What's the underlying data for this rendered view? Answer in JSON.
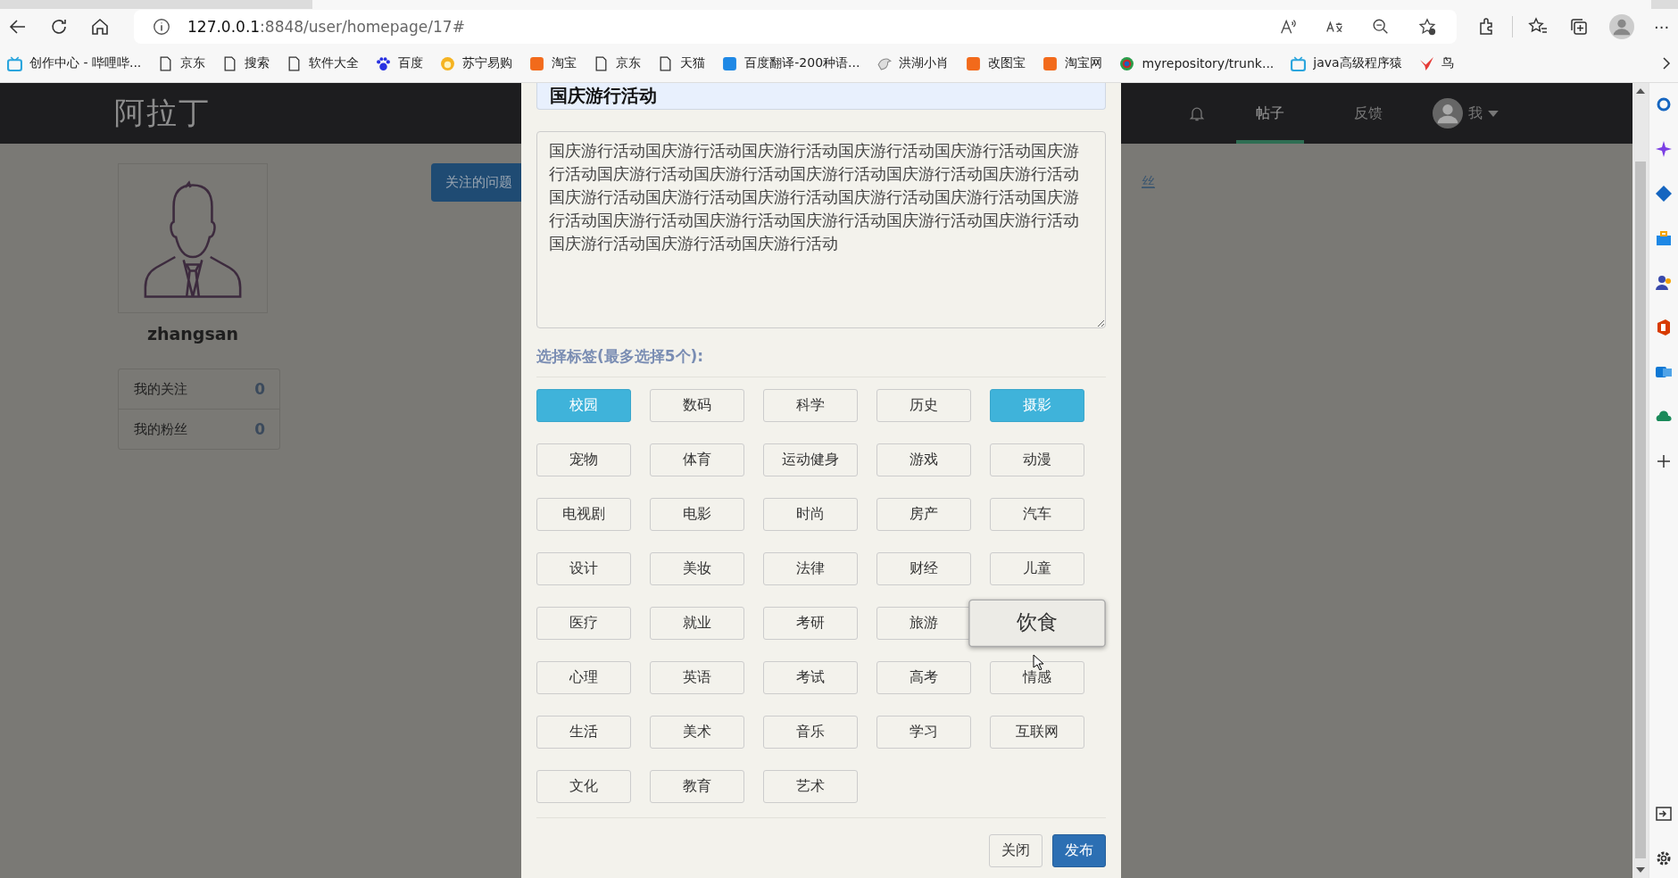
{
  "browser": {
    "url_host": "127.0.0.1",
    "url_path": ":8848/user/homepage/17#",
    "more": "···"
  },
  "bookmarks": [
    {
      "label": "创作中心 - 哔哩哔...",
      "kind": "tv"
    },
    {
      "label": "京东",
      "kind": "page"
    },
    {
      "label": "搜索",
      "kind": "page"
    },
    {
      "label": "软件大全",
      "kind": "page"
    },
    {
      "label": "百度",
      "kind": "paw"
    },
    {
      "label": "苏宁易购",
      "kind": "sun"
    },
    {
      "label": "淘宝",
      "kind": "orange"
    },
    {
      "label": "京东",
      "kind": "page"
    },
    {
      "label": "天猫",
      "kind": "page"
    },
    {
      "label": "百度翻译-200种语...",
      "kind": "blue"
    },
    {
      "label": "洪湖小肖",
      "kind": "bird"
    },
    {
      "label": "改图宝",
      "kind": "orange"
    },
    {
      "label": "淘宝网",
      "kind": "orange"
    },
    {
      "label": "myrepository/trunk...",
      "kind": "ring"
    },
    {
      "label": "java高级程序猿",
      "kind": "tv"
    },
    {
      "label": "鸟",
      "kind": "redbird"
    }
  ],
  "site": {
    "logo": "阿拉丁",
    "nav": [
      {
        "label": "帖子",
        "selected": true
      },
      {
        "label": "反馈",
        "selected": false
      }
    ],
    "user_menu": "我"
  },
  "profile": {
    "username": "zhangsan",
    "stats": [
      {
        "label": "我的关注",
        "value": "0"
      },
      {
        "label": "我的粉丝",
        "value": "0"
      }
    ]
  },
  "tab_button": "关注的问题",
  "link_fragment": "丝",
  "modal": {
    "title_value": "国庆游行活动",
    "content": "国庆游行活动国庆游行活动国庆游行活动国庆游行活动国庆游行活动国庆游行活动国庆游行活动国庆游行活动国庆游行活动国庆游行活动国庆游行活动国庆游行活动国庆游行活动国庆游行活动国庆游行活动国庆游行活动国庆游行活动国庆游行活动国庆游行活动国庆游行活动国庆游行活动国庆游行活动国庆游行活动国庆游行活动国庆游行活动",
    "tags_label": "选择标签(最多选择5个):",
    "tags": [
      {
        "label": "校园",
        "selected": true,
        "hovered": false
      },
      {
        "label": "数码",
        "selected": false,
        "hovered": false
      },
      {
        "label": "科学",
        "selected": false,
        "hovered": false
      },
      {
        "label": "历史",
        "selected": false,
        "hovered": false
      },
      {
        "label": "摄影",
        "selected": true,
        "hovered": false
      },
      {
        "label": "宠物",
        "selected": false,
        "hovered": false
      },
      {
        "label": "体育",
        "selected": false,
        "hovered": false
      },
      {
        "label": "运动健身",
        "selected": false,
        "hovered": false
      },
      {
        "label": "游戏",
        "selected": false,
        "hovered": false
      },
      {
        "label": "动漫",
        "selected": false,
        "hovered": false
      },
      {
        "label": "电视剧",
        "selected": false,
        "hovered": false
      },
      {
        "label": "电影",
        "selected": false,
        "hovered": false
      },
      {
        "label": "时尚",
        "selected": false,
        "hovered": false
      },
      {
        "label": "房产",
        "selected": false,
        "hovered": false
      },
      {
        "label": "汽车",
        "selected": false,
        "hovered": false
      },
      {
        "label": "设计",
        "selected": false,
        "hovered": false
      },
      {
        "label": "美妆",
        "selected": false,
        "hovered": false
      },
      {
        "label": "法律",
        "selected": false,
        "hovered": false
      },
      {
        "label": "财经",
        "selected": false,
        "hovered": false
      },
      {
        "label": "儿童",
        "selected": false,
        "hovered": false
      },
      {
        "label": "医疗",
        "selected": false,
        "hovered": false
      },
      {
        "label": "就业",
        "selected": false,
        "hovered": false
      },
      {
        "label": "考研",
        "selected": false,
        "hovered": false
      },
      {
        "label": "旅游",
        "selected": false,
        "hovered": false
      },
      {
        "label": "饮食",
        "selected": false,
        "hovered": true
      },
      {
        "label": "心理",
        "selected": false,
        "hovered": false
      },
      {
        "label": "英语",
        "selected": false,
        "hovered": false
      },
      {
        "label": "考试",
        "selected": false,
        "hovered": false
      },
      {
        "label": "高考",
        "selected": false,
        "hovered": false
      },
      {
        "label": "情感",
        "selected": false,
        "hovered": false
      },
      {
        "label": "生活",
        "selected": false,
        "hovered": false
      },
      {
        "label": "美术",
        "selected": false,
        "hovered": false
      },
      {
        "label": "音乐",
        "selected": false,
        "hovered": false
      },
      {
        "label": "学习",
        "selected": false,
        "hovered": false
      },
      {
        "label": "互联网",
        "selected": false,
        "hovered": false
      },
      {
        "label": "文化",
        "selected": false,
        "hovered": false
      },
      {
        "label": "教育",
        "selected": false,
        "hovered": false
      },
      {
        "label": "艺术",
        "selected": false,
        "hovered": false
      }
    ],
    "buttons": [
      {
        "label": "关闭",
        "kind": "default"
      },
      {
        "label": "发布",
        "kind": "primary"
      }
    ]
  }
}
